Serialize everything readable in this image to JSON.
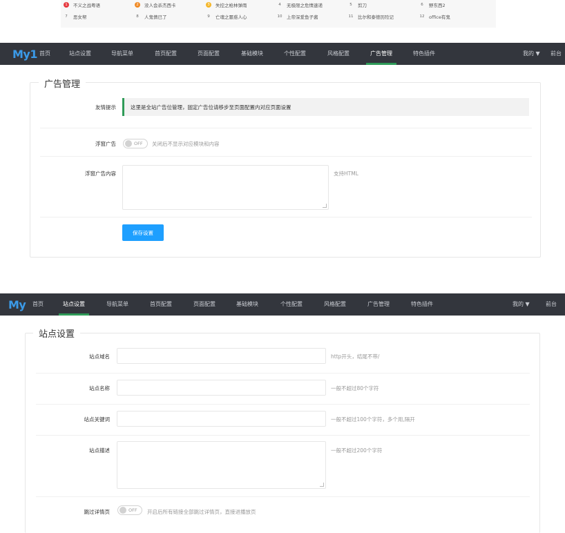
{
  "ranking": {
    "row1": [
      {
        "num": "1",
        "title": "不义之战粤语",
        "color": "#e6393f"
      },
      {
        "num": "2",
        "title": "没人会杀杰西卡",
        "color": "#f08a24"
      },
      {
        "num": "3",
        "title": "失控之枪林弹雨",
        "color": "#f5b72a"
      },
      {
        "num": "4",
        "title": "无极限之危情速递",
        "color": ""
      },
      {
        "num": "5",
        "title": "剪刀",
        "color": ""
      },
      {
        "num": "6",
        "title": "野东西2",
        "color": ""
      }
    ],
    "row2": [
      {
        "num": "7",
        "title": "恶女帮",
        "color": ""
      },
      {
        "num": "8",
        "title": "人鬼情已了",
        "color": ""
      },
      {
        "num": "9",
        "title": "亡魂之噩惑人心",
        "color": ""
      },
      {
        "num": "10",
        "title": "上帝深爱鱼子酱",
        "color": ""
      },
      {
        "num": "11",
        "title": "比尔和泰德历险记",
        "color": ""
      },
      {
        "num": "12",
        "title": "office有鬼",
        "color": ""
      }
    ]
  },
  "nav1": {
    "logo": "My1",
    "items": [
      "首页",
      "站点设置",
      "导航菜单",
      "首页配置",
      "页面配置",
      "基础模块",
      "个性配置",
      "风格配置",
      "广告管理",
      "特色插件"
    ],
    "active_index": 8,
    "mine": "我的 ▼",
    "front": "前台"
  },
  "ad_panel": {
    "legend": "广告管理",
    "tip_label": "友情提示",
    "tip_text": "这里是全站广告位管理，固定广告位请移步至页面配置内对应页面设置",
    "float_label": "浮窗广告",
    "float_switch": "OFF",
    "float_hint": "关闭后不显示对应模块和内容",
    "content_label": "浮窗广告内容",
    "content_value": "",
    "content_hint": "支持HTML",
    "save_label": "保存设置"
  },
  "nav2": {
    "logo": "My",
    "items": [
      "首页",
      "站点设置",
      "导航菜单",
      "首页配置",
      "页面配置",
      "基础模块",
      "个性配置",
      "风格配置",
      "广告管理",
      "特色插件"
    ],
    "active_index": 1,
    "mine": "我的 ▼",
    "front": "前台"
  },
  "site_panel": {
    "legend": "站点设置",
    "domain_label": "站点域名",
    "domain_value": "",
    "domain_hint": "http开头，结尾不带/",
    "name_label": "站点名称",
    "name_value": "",
    "name_hint": "一般不超过80个字符",
    "keywords_label": "站点关键词",
    "keywords_value": "",
    "keywords_hint": "一般不超过100个字符，多个用,隔开",
    "desc_label": "站点描述",
    "desc_value": "",
    "desc_hint": "一般不超过200个字符",
    "skip_label": "跳过详情页",
    "skip_switch": "OFF",
    "skip_hint": "开启后所有链接全部跳过详情页，直接进播放页"
  },
  "colors": {
    "nav_bg": "#33363d",
    "active_line": "#2f9b58",
    "primary_button": "#1e9fff",
    "logo": "#3b9ae8"
  }
}
